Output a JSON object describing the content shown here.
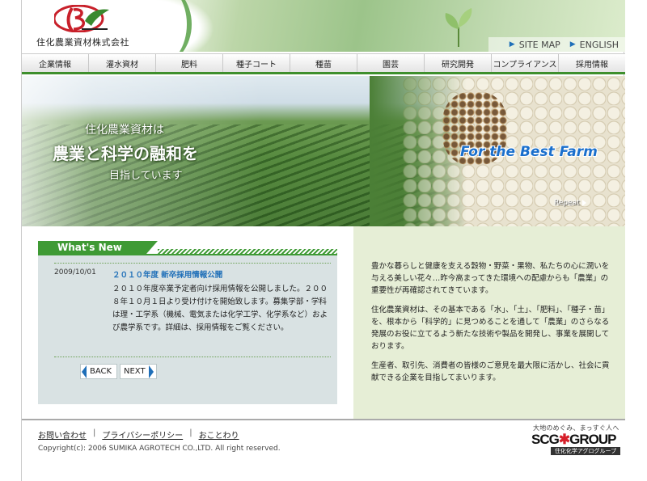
{
  "header": {
    "company_name": "住化農業資材株式会社",
    "toplinks": [
      {
        "label": "SITE MAP"
      },
      {
        "label": "ENGLISH"
      }
    ]
  },
  "nav": {
    "items": [
      "企業情報",
      "灌水資材",
      "肥料",
      "種子コート",
      "種苗",
      "園芸",
      "研究開発",
      "コンプライアンス",
      "採用情報"
    ]
  },
  "hero": {
    "line1": "住化農業資材は",
    "line2": "農業と科学の融和を",
    "line3": "目指しています",
    "slogan": "For the Best Farm",
    "repeat_label": "Repeat"
  },
  "news": {
    "heading": "What's New",
    "date": "2009/10/01",
    "title": "２０１０年度 新卒採用情報公開",
    "body": "２０１０年度卒業予定者向け採用情報を公開しました。２００８年１０月１日より受け付けを開始致します。募集学部・学科は理・工学系（機械、電気または化学工学、化学系など）および農学系です。詳細は、採用情報をご覧ください。",
    "back_label": "BACK",
    "next_label": "NEXT"
  },
  "intro": {
    "p1": "豊かな暮らしと健康を支える穀物・野菜・果物、私たちの心に潤いを与える美しい花々…昨今高まってきた環境への配慮からも「農業」の重要性が再確認されてきています。",
    "p2": "住化農業資材は、その基本である「水」、「土」、「肥料」、「種子・苗」を、根本から「科学的」に見つめることを通して「農業」のさらなる発展のお役に立てるよう新たな技術や製品を開発し、事業を展開しております。",
    "p3": "生産者、取引先、消費者の皆様のご意見を最大限に活かし、社会に貢献できる企業を目指してまいります。"
  },
  "footer": {
    "links": [
      "お問い合わせ",
      "プライバシーポリシー",
      "おことわり"
    ],
    "copyright": "Copyright(c): 2006 SUMIKA AGROTECH CO.,LTD. All right reserved.",
    "scg_tagline": "大地のめぐみ、まっすぐ人へ",
    "scg_logo_left": "SCG",
    "scg_logo_right": "GROUP",
    "scg_sub": "住化化学アグログループ"
  },
  "colors": {
    "brand_green": "#3f9a35",
    "link_blue": "#1f6fb8",
    "news_bg": "#d9e2e3",
    "intro_bg": "#e6eed6"
  }
}
